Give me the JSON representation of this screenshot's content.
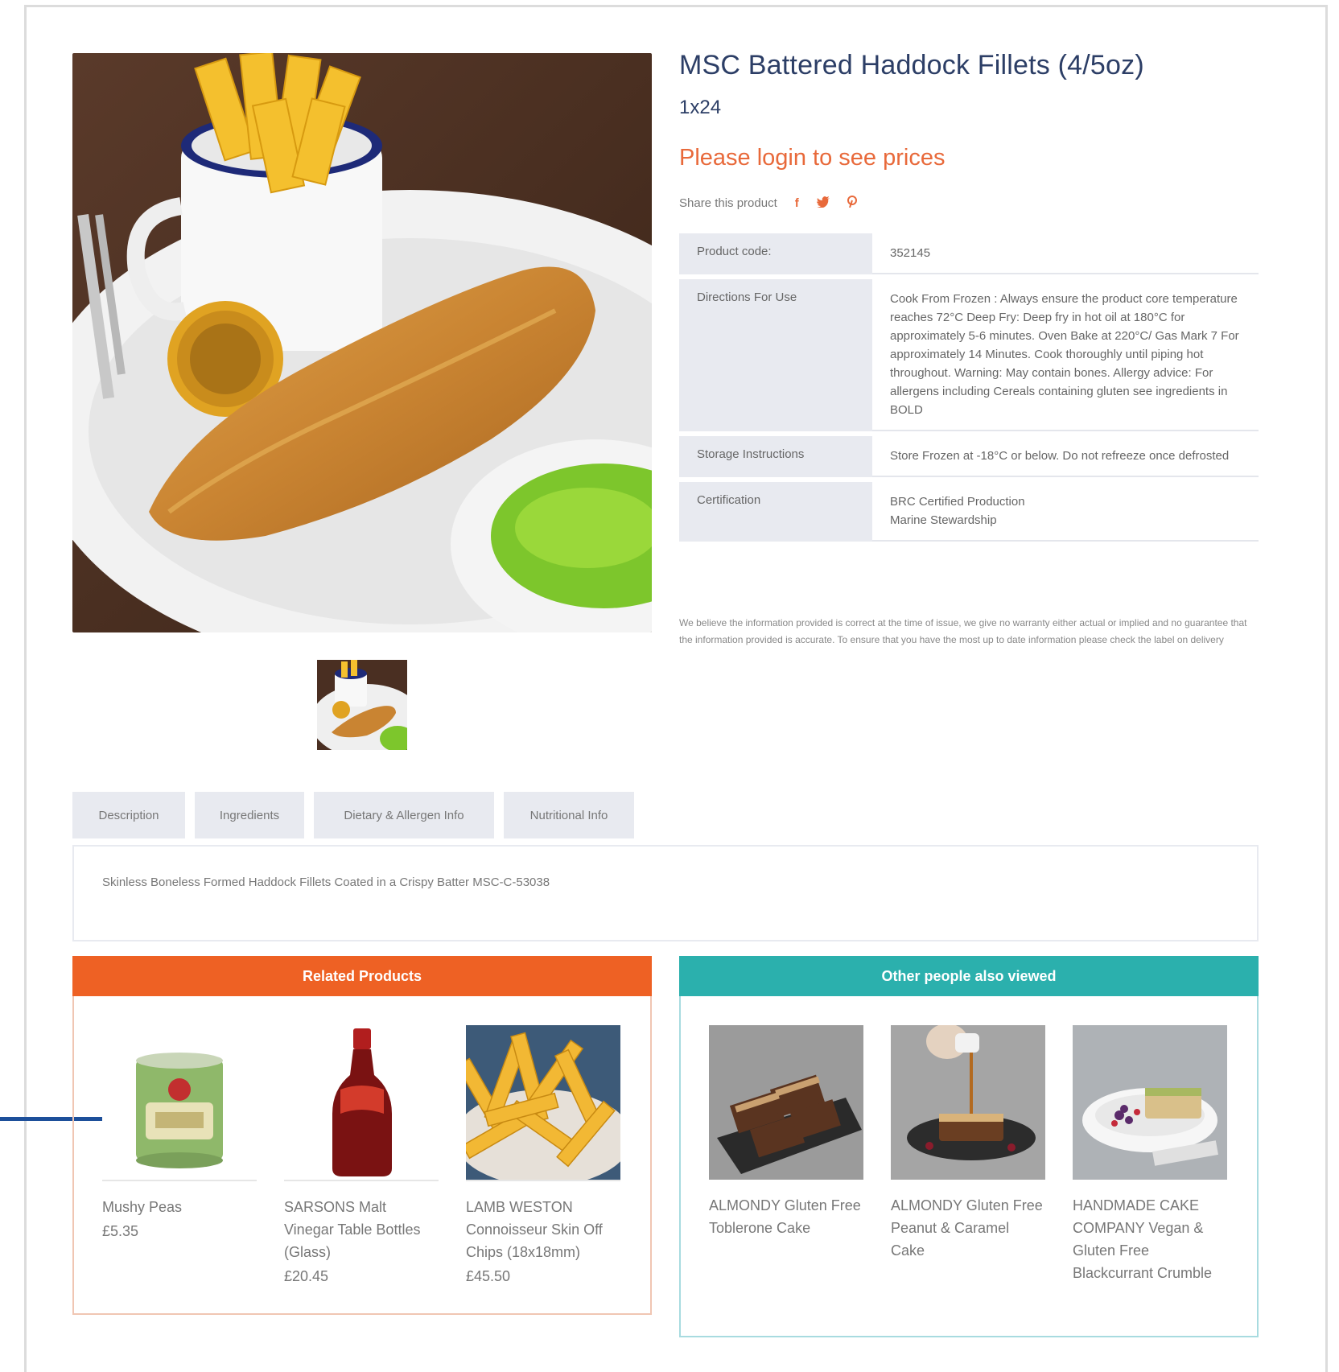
{
  "product": {
    "title": "MSC Battered Haddock Fillets (4/5oz)",
    "pack_size": "1x24",
    "login_prompt": "Please login to see prices",
    "share_label": "Share this product",
    "share_icons": [
      "facebook-icon",
      "twitter-icon",
      "pinterest-icon"
    ],
    "specs": [
      {
        "label": "Product code:",
        "value": "352145"
      },
      {
        "label": "Directions For Use",
        "value": "Cook From Frozen : Always ensure the product core temperature reaches 72°C Deep Fry: Deep fry in hot oil at 180°C for approximately 5-6 minutes. Oven Bake at 220°C/ Gas Mark 7 For approximately 14 Minutes. Cook thoroughly until piping hot throughout. Warning: May contain bones. Allergy advice: For allergens including Cereals containing gluten see ingredients in BOLD"
      },
      {
        "label": "Storage Instructions",
        "value": "Store Frozen at -18°C or below. Do not refreeze once defrosted"
      },
      {
        "label": "Certification",
        "value": "BRC Certified Production\nMarine Stewardship"
      }
    ],
    "disclaimer": "We believe the information provided is correct at the time of issue, we give no warranty either actual or implied and no guarantee that the information provided is accurate. To ensure that you have the most up to date information please check the label on delivery"
  },
  "tabs": {
    "items": [
      "Description",
      "Ingredients",
      "Dietary & Allergen Info",
      "Nutritional Info"
    ],
    "description_text": "Skinless Boneless Formed Haddock Fillets Coated in a Crispy Batter MSC-C-53038"
  },
  "related": {
    "heading": "Related Products",
    "items": [
      {
        "name": "Mushy Peas",
        "price": "£5.35"
      },
      {
        "name": "SARSONS Malt Vinegar Table Bottles (Glass)",
        "price": "£20.45"
      },
      {
        "name": "LAMB WESTON Connoisseur Skin Off Chips (18x18mm)",
        "price": "£45.50"
      }
    ]
  },
  "viewed": {
    "heading": "Other people also viewed",
    "items": [
      {
        "name": "ALMONDY Gluten Free Toblerone Cake"
      },
      {
        "name": "ALMONDY Gluten Free Peanut & Caramel Cake"
      },
      {
        "name": "HANDMADE CAKE COMPANY Vegan & Gluten Free Blackcurrant Crumble"
      }
    ]
  },
  "colors": {
    "title": "#2c3e66",
    "login": "#e8693a",
    "related_header": "#ee6124",
    "viewed_header": "#2bb0ad",
    "annotation": "#1d4f9a"
  }
}
